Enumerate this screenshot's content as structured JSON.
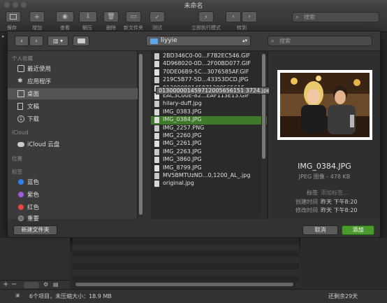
{
  "window": {
    "title": "未命名"
  },
  "toolbar": {
    "buttons": [
      "保存",
      "增加",
      "查看",
      "解压",
      "删除",
      "新文件夹",
      "测试",
      "立即执行模式",
      "转到"
    ],
    "search_placeholder": "搜索"
  },
  "dialog": {
    "location": "liyyie",
    "search_placeholder": "搜索",
    "sidebar": {
      "sections": {
        "favorites": "个人收藏",
        "icloud": "iCloud",
        "locations": "位置",
        "tags": "标签"
      },
      "favorites": [
        "最近使用",
        "应用程序",
        "桌面",
        "文稿",
        "下载"
      ],
      "icloud_items": [
        "iCloud 云盘"
      ],
      "tags": [
        {
          "label": "蓝色",
          "color": "#2f7ff0"
        },
        {
          "label": "紫色",
          "color": "#a15bd6"
        },
        {
          "label": "红色",
          "color": "#e8454a"
        },
        {
          "label": "重要",
          "color": "#6a6a6a"
        }
      ]
    },
    "files": [
      "2BD346C0-00...F7B2EC546.GIF",
      "4D968020-0D...2F00BD077.GIF",
      "70DE06B9-5C...3076585AF.GIF",
      "219C5B77-5D...43353DCD.JPG",
      "01300000145971200565615...",
      "EAC3C00E-82...EAF113E13.GIF",
      "hilary-duff.jpg",
      "IMG_0383.JPG",
      "IMG_0384.JPG",
      "IMG_2257.PNG",
      "IMG_2260.JPG",
      "IMG_2261.JPG",
      "IMG_2263.JPG",
      "IMG_3860.JPG",
      "IMG_8799.JPG",
      "MV5BMTUzND...0,1200_AL_.jpg",
      "original.jpg"
    ],
    "selected_file": "IMG_0384.JPG",
    "tooltip": "013000001459712005656151 3724.jpeg",
    "preview": {
      "name": "IMG_0384.JPG",
      "info": "JPEG 图像 - 478 KB",
      "tags_label": "标签",
      "tags_value": "添加标签...",
      "created_label": "创建时间",
      "created_value": "昨天 下午8:20",
      "modified_label": "修改时间",
      "modified_value": "昨天 下午8:20"
    },
    "new_folder_label": "新建文件夹",
    "cancel_label": "取消",
    "add_label": "添加"
  },
  "status": {
    "text": "6个项目，未压缩大小：18.9 MB",
    "right": "还剩余29天"
  }
}
